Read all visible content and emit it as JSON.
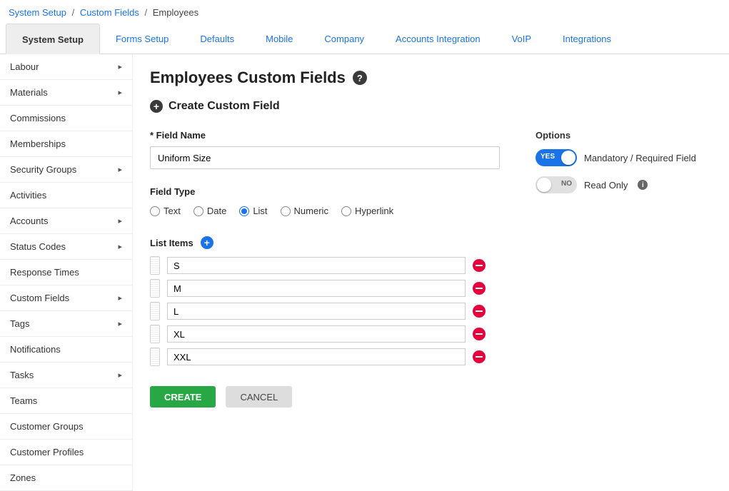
{
  "breadcrumb": {
    "items": [
      "System Setup",
      "Custom Fields",
      "Employees"
    ]
  },
  "topnav": {
    "tabs": [
      {
        "label": "System Setup",
        "active": true
      },
      {
        "label": "Forms Setup"
      },
      {
        "label": "Defaults"
      },
      {
        "label": "Mobile"
      },
      {
        "label": "Company"
      },
      {
        "label": "Accounts Integration"
      },
      {
        "label": "VoIP"
      },
      {
        "label": "Integrations"
      }
    ]
  },
  "sidebar": {
    "items": [
      {
        "label": "Labour",
        "hasChildren": true
      },
      {
        "label": "Materials",
        "hasChildren": true
      },
      {
        "label": "Commissions"
      },
      {
        "label": "Memberships"
      },
      {
        "label": "Security Groups",
        "hasChildren": true
      },
      {
        "label": "Activities"
      },
      {
        "label": "Accounts",
        "hasChildren": true
      },
      {
        "label": "Status Codes",
        "hasChildren": true
      },
      {
        "label": "Response Times"
      },
      {
        "label": "Custom Fields",
        "hasChildren": true
      },
      {
        "label": "Tags",
        "hasChildren": true
      },
      {
        "label": "Notifications"
      },
      {
        "label": "Tasks",
        "hasChildren": true
      },
      {
        "label": "Teams"
      },
      {
        "label": "Customer Groups"
      },
      {
        "label": "Customer Profiles"
      },
      {
        "label": "Zones"
      }
    ]
  },
  "page": {
    "title": "Employees Custom Fields",
    "subheader": "Create Custom Field"
  },
  "form": {
    "fieldNameLabel": "* Field Name",
    "fieldNameValue": "Uniform Size",
    "fieldTypeLabel": "Field Type",
    "fieldTypes": [
      {
        "label": "Text",
        "value": "text"
      },
      {
        "label": "Date",
        "value": "date"
      },
      {
        "label": "List",
        "value": "list",
        "selected": true
      },
      {
        "label": "Numeric",
        "value": "numeric"
      },
      {
        "label": "Hyperlink",
        "value": "hyperlink"
      }
    ],
    "listItemsLabel": "List Items",
    "listItems": [
      "S",
      "M",
      "L",
      "XL",
      "XXL"
    ],
    "createLabel": "CREATE",
    "cancelLabel": "CANCEL"
  },
  "options": {
    "title": "Options",
    "mandatory": {
      "label": "Mandatory / Required Field",
      "on": true,
      "yes": "YES",
      "no": "NO"
    },
    "readonly": {
      "label": "Read Only",
      "on": false,
      "yes": "YES",
      "no": "NO"
    }
  }
}
